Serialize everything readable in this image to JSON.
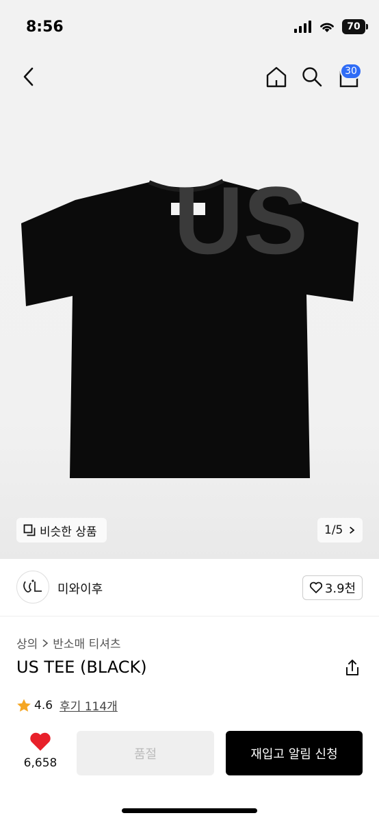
{
  "status": {
    "time": "8:56",
    "battery": "70"
  },
  "cart": {
    "badge": "30"
  },
  "product_image": {
    "print_text": "US"
  },
  "gallery": {
    "similar_label": "비슷한 상품",
    "page_indicator": "1/5"
  },
  "brand": {
    "name": "미와이후",
    "likes": "3.9천"
  },
  "breadcrumb": [
    "상의",
    "반소매 티셔츠"
  ],
  "product": {
    "title": "US TEE (BLACK)",
    "rating": "4.6",
    "reviews": "후기 114개"
  },
  "actions": {
    "wish_count": "6,658",
    "soldout_label": "품절",
    "restock_label": "재입고 알림 신청"
  },
  "colors": {
    "accent_blue": "#2f6cf6",
    "heart_red": "#e8202a",
    "star": "#f5a623"
  }
}
